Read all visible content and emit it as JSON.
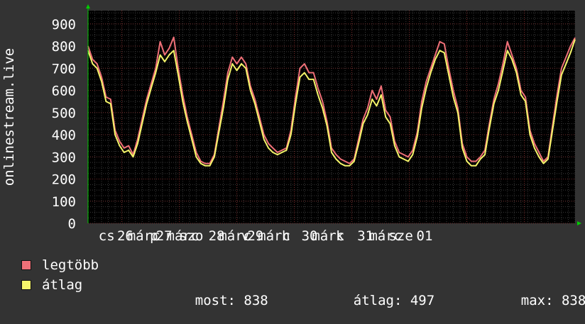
{
  "colors": {
    "background": "#333333",
    "plot_background": "#000000",
    "grid": "#5a5a5a",
    "max_series": "#f07078",
    "avg_series": "#f5f56a",
    "axis_arrow": "#00cc00"
  },
  "chart_data": {
    "type": "line",
    "ylabel": "onlinestream.live",
    "ylim": [
      0,
      960
    ],
    "yticks": [
      0,
      100,
      200,
      300,
      400,
      500,
      600,
      700,
      800,
      900
    ],
    "xlim": [
      0,
      144
    ],
    "xticks": [
      {
        "x": 5.5,
        "label": "cs"
      },
      {
        "x": 11,
        "label": "26"
      },
      {
        "x": 16.5,
        "label": "márc"
      },
      {
        "x": 19.5,
        "label": "p"
      },
      {
        "x": 22.5,
        "label": "27"
      },
      {
        "x": 28,
        "label": "márc"
      },
      {
        "x": 30.5,
        "label": "szo"
      },
      {
        "x": 38,
        "label": "28"
      },
      {
        "x": 43.5,
        "label": "márc"
      },
      {
        "x": 46.5,
        "label": "v"
      },
      {
        "x": 49.5,
        "label": "29"
      },
      {
        "x": 55,
        "label": "márc"
      },
      {
        "x": 58.5,
        "label": "h"
      },
      {
        "x": 65.5,
        "label": "30"
      },
      {
        "x": 71,
        "label": "márc"
      },
      {
        "x": 74.5,
        "label": "k"
      },
      {
        "x": 82,
        "label": "31"
      },
      {
        "x": 88,
        "label": "márc"
      },
      {
        "x": 92.5,
        "label": "sze"
      },
      {
        "x": 99.5,
        "label": "01"
      }
    ],
    "series": [
      {
        "name": "legtöbb",
        "values": [
          800,
          740,
          720,
          660,
          570,
          560,
          420,
          370,
          340,
          350,
          310,
          380,
          470,
          560,
          630,
          700,
          820,
          760,
          790,
          840,
          700,
          580,
          480,
          400,
          320,
          280,
          270,
          270,
          310,
          430,
          550,
          680,
          750,
          720,
          750,
          720,
          620,
          560,
          480,
          400,
          360,
          340,
          320,
          330,
          340,
          420,
          570,
          700,
          720,
          680,
          680,
          610,
          550,
          460,
          340,
          310,
          290,
          280,
          270,
          290,
          380,
          470,
          520,
          600,
          560,
          620,
          510,
          480,
          370,
          320,
          310,
          300,
          330,
          410,
          550,
          640,
          700,
          760,
          820,
          810,
          700,
          600,
          520,
          360,
          300,
          280,
          280,
          300,
          330,
          450,
          560,
          630,
          720,
          820,
          760,
          700,
          600,
          570,
          420,
          360,
          320,
          280,
          300,
          440,
          580,
          700,
          750,
          800,
          838
        ],
        "xstart": 0
      },
      {
        "name": "átlag",
        "values": [
          780,
          720,
          700,
          640,
          550,
          540,
          400,
          350,
          320,
          330,
          300,
          360,
          450,
          540,
          610,
          680,
          760,
          730,
          760,
          780,
          670,
          550,
          460,
          380,
          300,
          270,
          260,
          260,
          300,
          410,
          520,
          650,
          720,
          690,
          720,
          700,
          600,
          540,
          460,
          380,
          340,
          320,
          310,
          320,
          330,
          400,
          540,
          660,
          680,
          650,
          650,
          580,
          520,
          440,
          320,
          290,
          270,
          260,
          260,
          280,
          360,
          450,
          490,
          560,
          530,
          580,
          480,
          450,
          350,
          300,
          290,
          280,
          310,
          390,
          520,
          610,
          680,
          740,
          780,
          770,
          670,
          570,
          500,
          340,
          280,
          260,
          260,
          290,
          310,
          430,
          540,
          600,
          690,
          780,
          740,
          680,
          580,
          550,
          400,
          340,
          300,
          270,
          290,
          420,
          550,
          670,
          720,
          770,
          830
        ],
        "xstart": 0
      }
    ],
    "legend": {
      "items": [
        {
          "name": "legtöbb",
          "color": "#f07078"
        },
        {
          "name": "átlag",
          "color": "#f5f56a"
        }
      ],
      "stats": {
        "most_label": "most:",
        "most_value": "838",
        "atlag_label": "átlag:",
        "atlag_value": "497",
        "max_label": "max:",
        "max_value": "838"
      }
    }
  }
}
